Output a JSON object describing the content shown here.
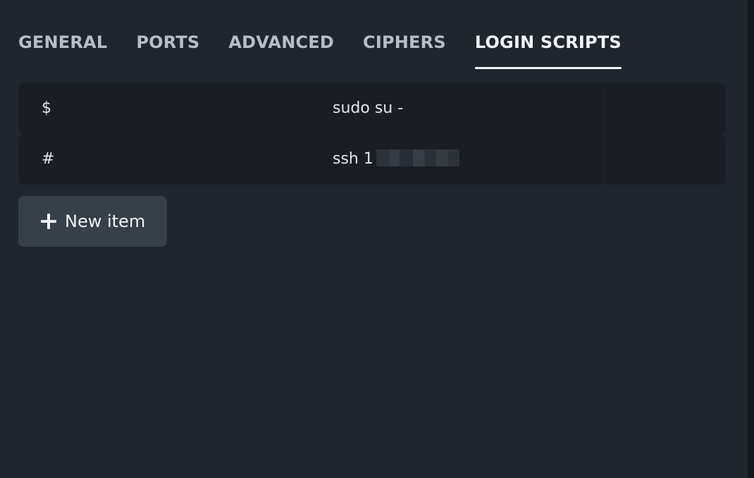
{
  "tabs": [
    {
      "label": "GENERAL",
      "active": false
    },
    {
      "label": "PORTS",
      "active": false
    },
    {
      "label": "ADVANCED",
      "active": false
    },
    {
      "label": "CIPHERS",
      "active": false
    },
    {
      "label": "LOGIN SCRIPTS",
      "active": true
    }
  ],
  "scripts": [
    {
      "expect": "$",
      "send": "sudo su -"
    },
    {
      "expect": "#",
      "send": "ssh 1"
    }
  ],
  "new_item": {
    "label": "New item",
    "icon": "plus-icon"
  },
  "colors": {
    "background": "#20262e",
    "row": "#1a1e24",
    "button": "#373f48",
    "active_tab": "#f3f5f8",
    "inactive_tab": "#b6bec8"
  }
}
